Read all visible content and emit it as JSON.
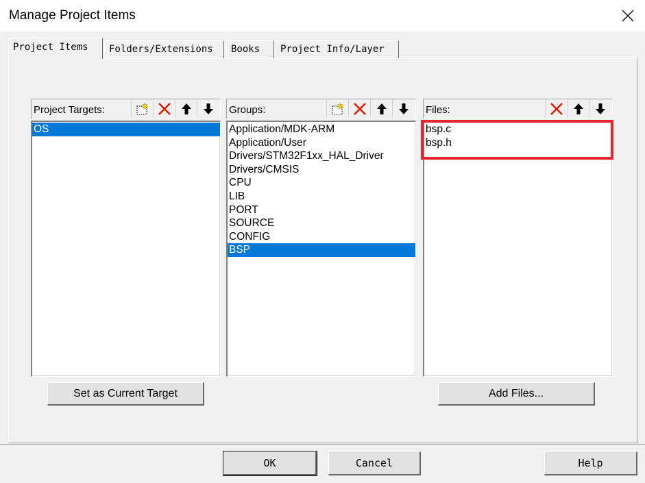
{
  "window": {
    "title": "Manage Project Items"
  },
  "tabs": [
    {
      "label": "Project Items",
      "active": true
    },
    {
      "label": "Folders/Extensions",
      "active": false
    },
    {
      "label": "Books",
      "active": false
    },
    {
      "label": "Project Info/Layer",
      "active": false
    }
  ],
  "targets": {
    "label": "Project Targets:",
    "items": [
      "OS"
    ],
    "selected_index": 0,
    "set_current_label": "Set as Current Target"
  },
  "groups": {
    "label": "Groups:",
    "items": [
      "Application/MDK-ARM",
      "Application/User",
      "Drivers/STM32F1xx_HAL_Driver",
      "Drivers/CMSIS",
      "CPU",
      "LIB",
      "PORT",
      "SOURCE",
      "CONFIG",
      "BSP"
    ],
    "selected_index": 9
  },
  "files": {
    "label": "Files:",
    "items": [
      "bsp.c",
      "bsp.h"
    ],
    "add_files_label": "Add Files..."
  },
  "footer": {
    "ok_label": "OK",
    "cancel_label": "Cancel",
    "help_label": "Help"
  },
  "colors": {
    "selection": "#0078d7",
    "highlight_box": "#e8252b",
    "delete_red": "#d81e06"
  },
  "icons": {
    "new": "new-item-icon",
    "delete": "delete-x-icon",
    "up": "arrow-up-icon",
    "down": "arrow-down-icon",
    "close": "close-icon"
  }
}
